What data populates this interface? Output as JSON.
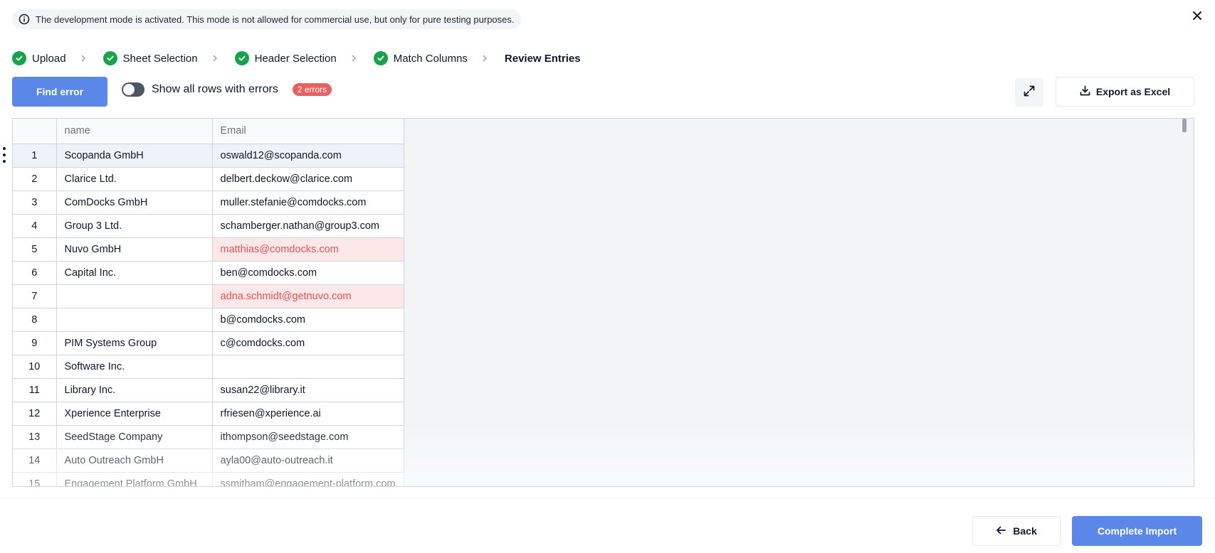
{
  "banner": {
    "text": "The development mode is activated. This mode is not allowed for commercial use, but only for pure testing purposes.",
    "icon": "info-icon"
  },
  "stepper": {
    "steps": [
      {
        "label": "Upload",
        "status": "complete"
      },
      {
        "label": "Sheet Selection",
        "status": "complete"
      },
      {
        "label": "Header Selection",
        "status": "complete"
      },
      {
        "label": "Match Columns",
        "status": "complete"
      },
      {
        "label": "Review Entries",
        "status": "current"
      }
    ]
  },
  "toolbar": {
    "find_error_label": "Find error",
    "toggle_label": "Show all rows with errors",
    "toggle_on": false,
    "error_badge": "2 errors",
    "export_label": "Export as Excel"
  },
  "table": {
    "columns": [
      "name",
      "Email"
    ],
    "rows": [
      {
        "num": "1",
        "name": "Scopanda GmbH",
        "email": "oswald12@scopanda.com"
      },
      {
        "num": "2",
        "name": "Clarice Ltd.",
        "email": "delbert.deckow@clarice.com"
      },
      {
        "num": "3",
        "name": "ComDocks GmbH",
        "email": "muller.stefanie@comdocks.com"
      },
      {
        "num": "4",
        "name": "Group 3 Ltd.",
        "email": "schamberger.nathan@group3.com"
      },
      {
        "num": "5",
        "name": "Nuvo GmbH",
        "email": "matthias@comdocks.com"
      },
      {
        "num": "6",
        "name": "Capital Inc.",
        "email": "ben@comdocks.com"
      },
      {
        "num": "7",
        "name": "",
        "email": "adna.schmidt@getnuvo.com"
      },
      {
        "num": "8",
        "name": "",
        "email": "b@comdocks.com"
      },
      {
        "num": "9",
        "name": "PIM Systems Group",
        "email": "c@comdocks.com"
      },
      {
        "num": "10",
        "name": "Software Inc.",
        "email": ""
      },
      {
        "num": "11",
        "name": "Library Inc.",
        "email": "susan22@library.it"
      },
      {
        "num": "12",
        "name": "Xperience Enterprise",
        "email": "rfriesen@xperience.ai"
      },
      {
        "num": "13",
        "name": "SeedStage Company",
        "email": "ithompson@seedstage.com"
      },
      {
        "num": "14",
        "name": "Auto Outreach GmbH",
        "email": "ayla00@auto-outreach.it"
      },
      {
        "num": "15",
        "name": "Engagement Platform GmbH",
        "email": "ssmitham@engagement-platform.com"
      }
    ]
  },
  "footer": {
    "back_label": "Back",
    "complete_label": "Complete Import"
  },
  "colors": {
    "primary": "#5b87e8",
    "success": "#16a34a",
    "error": "#e05252",
    "error_bg": "#fce8e8"
  }
}
